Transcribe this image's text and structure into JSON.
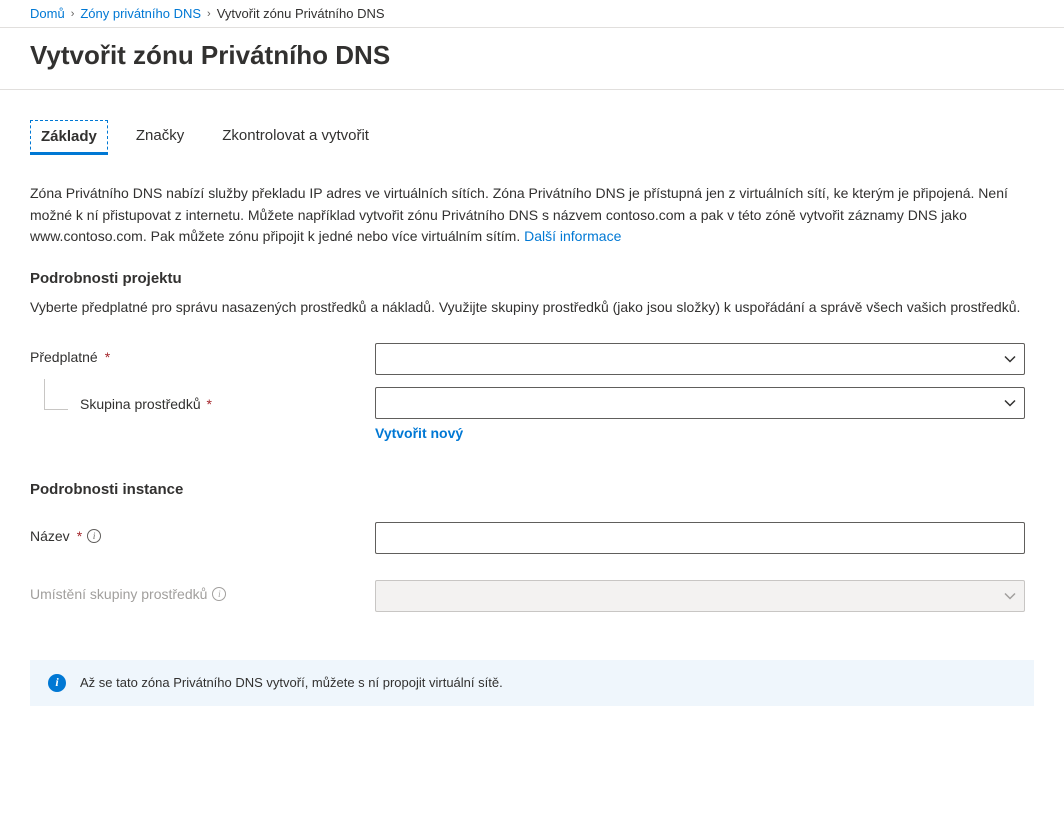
{
  "breadcrumb": {
    "home": "Domů",
    "zones": "Zóny privátního DNS",
    "current": "Vytvořit zónu Privátního DNS"
  },
  "page": {
    "title": "Vytvořit zónu Privátního DNS"
  },
  "tabs": {
    "basics": "Základy",
    "tags": "Značky",
    "review": "Zkontrolovat a vytvořit"
  },
  "description": {
    "text": "Zóna Privátního DNS nabízí služby překladu IP adres ve virtuálních sítích. Zóna Privátního DNS je přístupná jen z virtuálních sítí, ke kterým je připojená. Není možné k ní přistupovat z internetu. Můžete například vytvořit zónu Privátního DNS s názvem contoso.com a pak v této zóně vytvořit záznamy DNS jako www.contoso.com. Pak můžete zónu připojit k jedné nebo více virtuálním sítím. ",
    "more_info": "Další informace"
  },
  "project_details": {
    "heading": "Podrobnosti projektu",
    "text": "Vyberte předplatné pro správu nasazených prostředků a nákladů. Využijte skupiny prostředků (jako jsou složky) k uspořádání a správě všech vašich prostředků.",
    "subscription_label": "Předplatné",
    "resource_group_label": "Skupina prostředků",
    "create_new": "Vytvořit nový"
  },
  "instance_details": {
    "heading": "Podrobnosti instance",
    "name_label": "Název",
    "location_label": "Umístění skupiny prostředků"
  },
  "banner": {
    "text": "Až se tato zóna Privátního DNS vytvoří, můžete s ní propojit virtuální sítě."
  }
}
